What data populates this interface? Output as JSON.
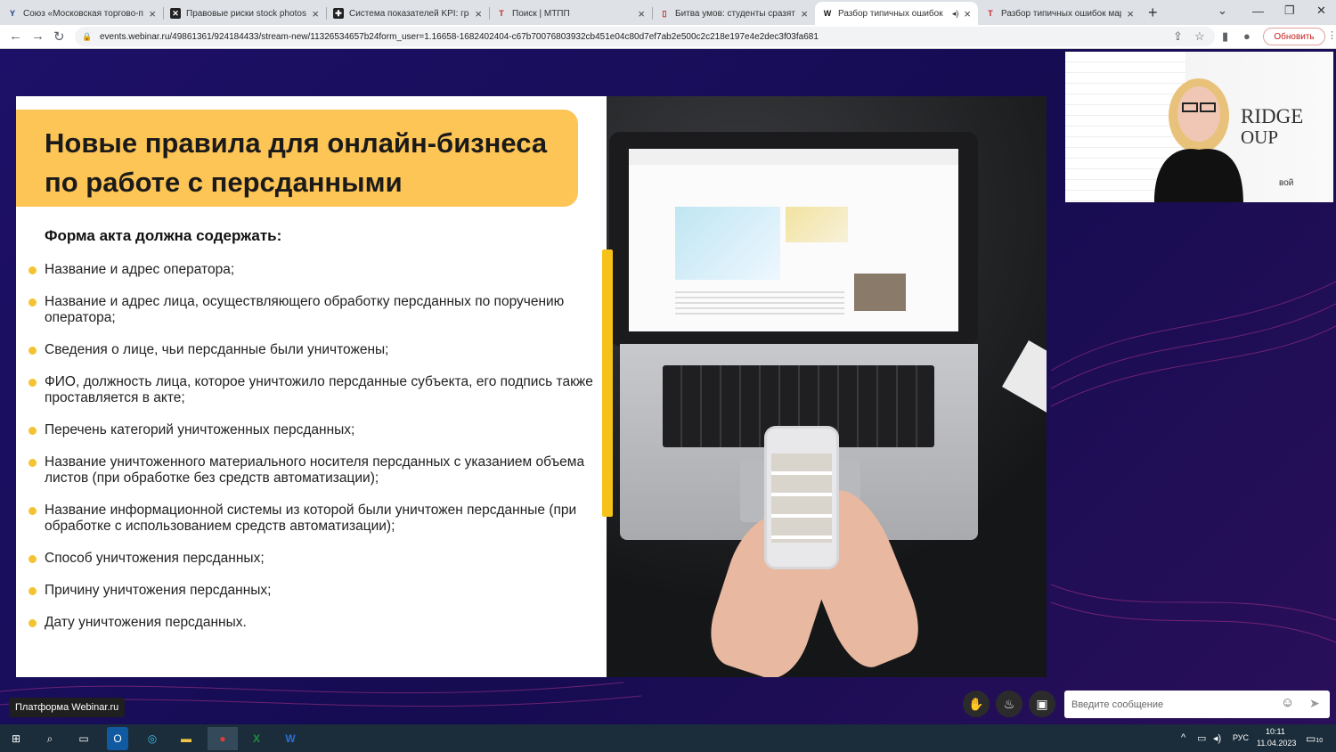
{
  "browser": {
    "tabs": [
      {
        "title": "Союз «Московская торгово-пр",
        "favicon": "union-favicon",
        "fav_glyph": "Y",
        "fav_color": "#1b3a8c",
        "fav_bg": "transparent"
      },
      {
        "title": "Правовые риски stock photos,",
        "favicon": "stock-favicon",
        "fav_glyph": "✕",
        "fav_color": "#fff",
        "fav_bg": "#222"
      },
      {
        "title": "Система показателей KPI: грам",
        "favicon": "kpi-favicon",
        "fav_glyph": "✚",
        "fav_color": "#fff",
        "fav_bg": "#222"
      },
      {
        "title": "Поиск | МТПП",
        "favicon": "mtpp-favicon",
        "fav_glyph": "T",
        "fav_color": "#c62828",
        "fav_bg": "transparent"
      },
      {
        "title": "Битва умов: студенты сразятся",
        "favicon": "news-favicon",
        "fav_glyph": "▯",
        "fav_color": "#c62828",
        "fav_bg": "transparent"
      },
      {
        "title": "Разбор типичных ошибок",
        "favicon": "webinar-favicon",
        "fav_glyph": "W",
        "fav_color": "#111",
        "fav_bg": "transparent",
        "active": true,
        "audio": "◂)"
      },
      {
        "title": "Разбор типичных ошибок мар",
        "favicon": "mtpp-favicon-2",
        "fav_glyph": "T",
        "fav_color": "#c62828",
        "fav_bg": "transparent"
      }
    ],
    "new_tab": "+",
    "url": "events.webinar.ru/49861361/924184433/stream-new/11326534657b24form_user=1.16658-1682402404-c67b70076803932cb451e04c80d7ef7ab2e500c2c218e197e4e2dec3f03fa681",
    "update_button": "Обновить"
  },
  "slide": {
    "title_line1": "Новые правила для онлайн-бизнеса",
    "title_line2": "по работе с персданными",
    "subheading": "Форма акта должна содержать:",
    "bullets": [
      "Название и адрес оператора;",
      "Название и адрес лица, осуществляющего обработку персданных по поручению оператора;",
      "Сведения о лице, чьи персданные были уничтожены;",
      "ФИО, должность лица, которое уничтожило персданные субъекта, его подпись также проставляется в акте;",
      "Перечень категорий уничтоженных персданных;",
      "Название уничтоженного материального носителя персданных с указанием объема листов (при обработке без средств автоматизации);",
      "Название информационной системы из которой были уничтожен персданные (при обработке с использованием средств автоматизации);",
      "Способ уничтожения персданных;",
      "Причину уничтожения персданных;",
      "Дату уничтожения персданных."
    ],
    "accent_color": "#fdc456"
  },
  "webcam": {
    "brand_line1": "RIDGE",
    "brand_line2": "OUP",
    "side_text": "вой"
  },
  "player": {
    "platform_label": "Платформа Webinar.ru",
    "chat_placeholder": "Введите сообщение"
  },
  "taskbar": {
    "language": "РУС",
    "time": "10:11",
    "date": "11.04.2023",
    "notifications": "10"
  }
}
